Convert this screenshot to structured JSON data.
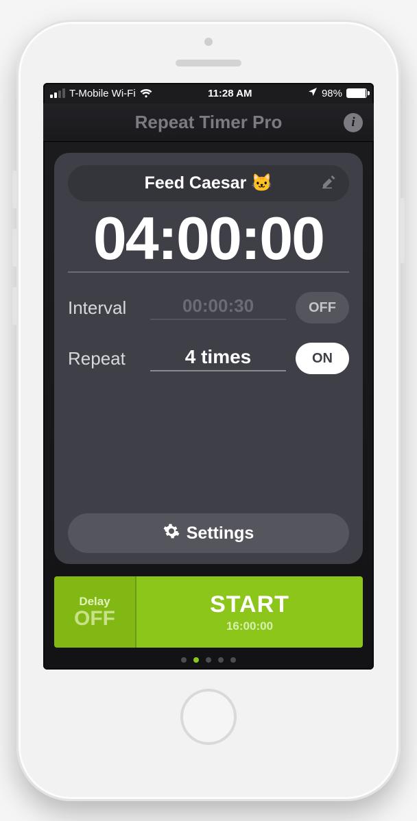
{
  "status": {
    "carrier": "T-Mobile Wi-Fi",
    "time": "11:28 AM",
    "battery_pct": "98%"
  },
  "header": {
    "title": "Repeat Timer Pro"
  },
  "timer": {
    "name": "Feed Caesar 🐱",
    "duration": "04:00:00",
    "interval_label": "Interval",
    "interval_value": "00:00:30",
    "interval_toggle": "OFF",
    "repeat_label": "Repeat",
    "repeat_value": "4 times",
    "repeat_toggle": "ON",
    "settings_label": "Settings"
  },
  "actions": {
    "delay_label": "Delay",
    "delay_value": "OFF",
    "start_label": "START",
    "start_sub": "16:00:00"
  },
  "pager": {
    "count": 5,
    "active_index": 1
  }
}
